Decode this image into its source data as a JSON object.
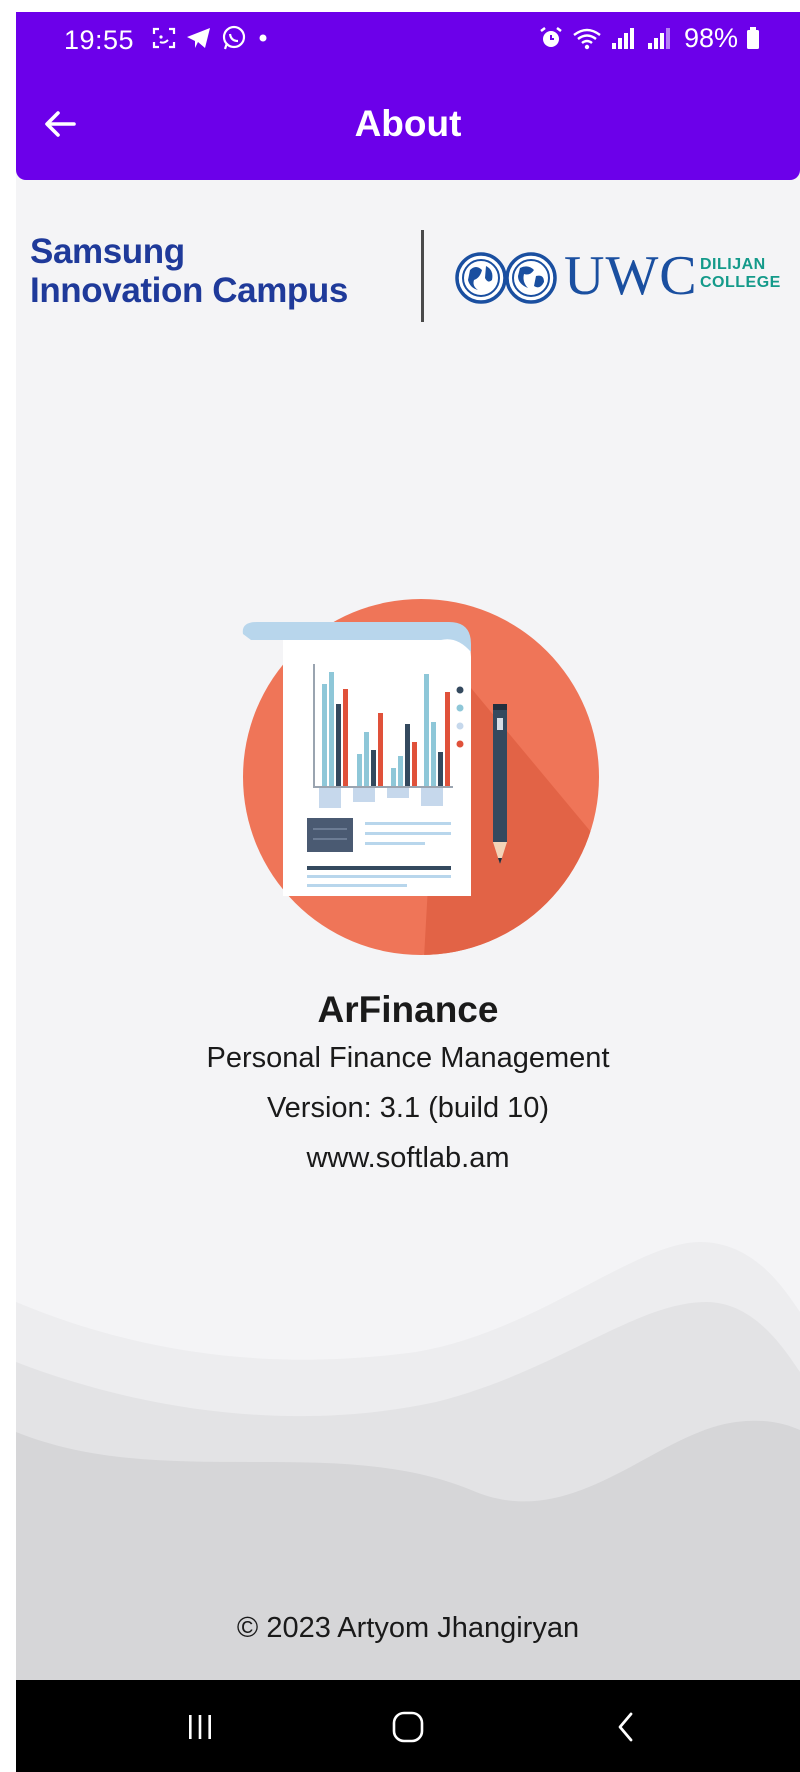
{
  "status_bar": {
    "time": "19:55",
    "battery": "98%",
    "left_icons": [
      "screenshot-icon",
      "telegram-icon",
      "whatsapp-icon",
      "notification-dot-icon"
    ],
    "right_icons": [
      "alarm-icon",
      "wifi-icon",
      "signal-icon",
      "signal-icon",
      "battery-icon"
    ]
  },
  "app_bar": {
    "title": "About",
    "back_icon": "arrow-left-icon",
    "background_color": "#6c00ea"
  },
  "partners": {
    "samsung_line1": "Samsung",
    "samsung_line2": "Innovation Campus",
    "uwc_wordmark": "UWC",
    "uwc_subtitle_line1": "DILIJAN",
    "uwc_subtitle_line2": "COLLEGE"
  },
  "app_info": {
    "name": "ArFinance",
    "description": "Personal Finance Management",
    "version": "Version: 3.1 (build 10)",
    "website": "www.softlab.am"
  },
  "footer": {
    "copyright": "© 2023 Artyom Jhangiryan"
  },
  "nav_bar": {
    "icons": [
      "recent-apps-icon",
      "home-icon",
      "back-icon"
    ]
  },
  "colors": {
    "accent": "#6c00ea",
    "illustration_circle": "#ef7558",
    "samsung_blue": "#1f3a9a",
    "uwc_blue": "#1a4fa0",
    "uwc_teal": "#149a8a"
  }
}
